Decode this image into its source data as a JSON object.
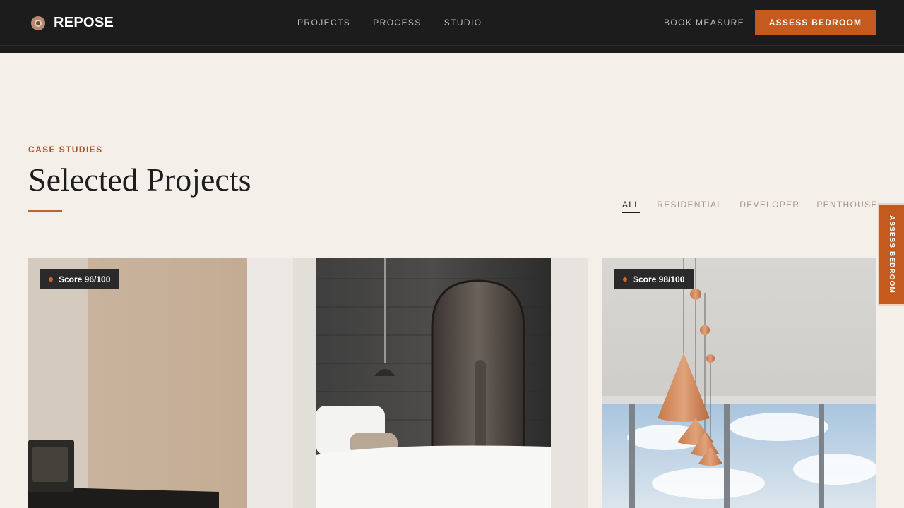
{
  "brand": {
    "name": "REPOSE",
    "logo_icon": "repose-logo-icon"
  },
  "nav": {
    "items": [
      "PROJECTS",
      "PROCESS",
      "STUDIO"
    ]
  },
  "header": {
    "book_label": "BOOK MEASURE",
    "cta_label": "ASSESS BEDROOM"
  },
  "section": {
    "eyebrow": "CASE STUDIES",
    "title": "Selected Projects",
    "filters": [
      "ALL",
      "RESIDENTIAL",
      "DEVELOPER",
      "PENTHOUSE"
    ],
    "active_filter": "ALL"
  },
  "side_tab": {
    "label": "ASSESS BEDROOM"
  },
  "projects": [
    {
      "score": "Score 96/100",
      "image": "bedroom-with-arched-wardrobe"
    },
    {
      "score": "Score 98/100",
      "image": "penthouse-copper-pendant-lights"
    }
  ],
  "colors": {
    "accent": "#c45a1e",
    "header_bg": "#1c1c1c",
    "page_bg": "#f5efe9"
  }
}
